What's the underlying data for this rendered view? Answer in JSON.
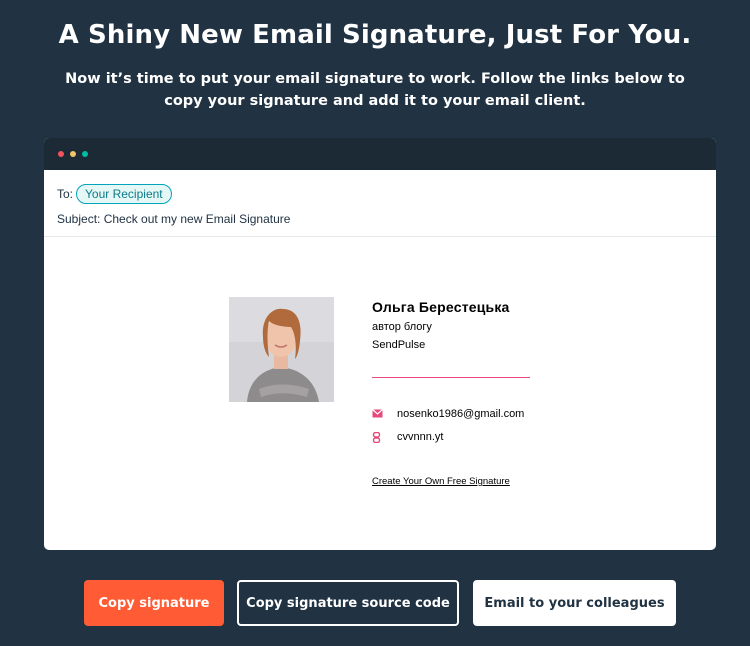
{
  "page": {
    "headline": "A Shiny New Email Signature, Just For You.",
    "subline": "Now it’s time to put your email signature to work. Follow the links below to copy your signature and add it to your email client."
  },
  "email_window": {
    "to_label": "To:",
    "recipient": "Your Recipient",
    "subject": "Subject: Check out my new Email Signature",
    "window_dots": [
      "red",
      "yellow",
      "green"
    ]
  },
  "signature": {
    "name": "Ольга  Берестецька",
    "role": "автор блогу",
    "company": "SendPulse",
    "email": "nosenko1986@gmail.com",
    "website": "cvvnnn.yt",
    "cta": "Create Your Own Free Signature",
    "accent_color": "#e6497a",
    "icons": [
      "mail-icon",
      "link-icon"
    ]
  },
  "actions": {
    "copy_signature": "Copy signature",
    "copy_source": "Copy signature source code",
    "email_colleagues": "Email to your colleagues"
  },
  "colors": {
    "background": "#213343",
    "primary_button": "#ff5c35",
    "chip_border": "#00a4bd"
  }
}
